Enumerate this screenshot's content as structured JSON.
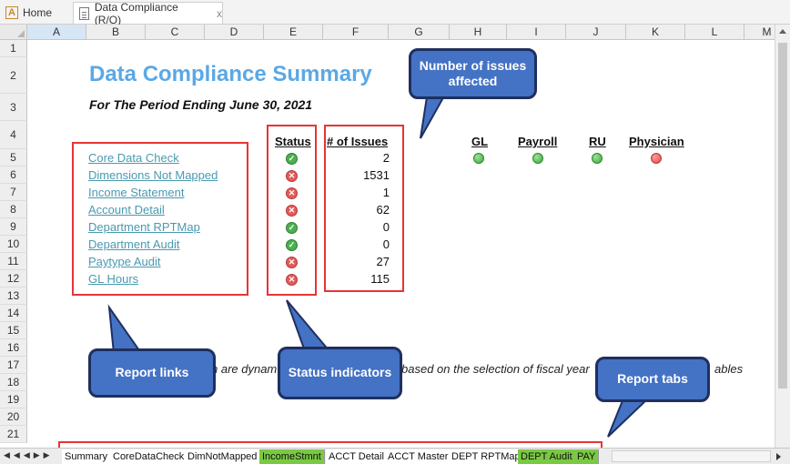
{
  "doc_tabs": {
    "home": "Home",
    "active": "Data Compliance (R/O)",
    "close": "x",
    "home_icon": "A"
  },
  "columns": [
    "A",
    "B",
    "C",
    "D",
    "E",
    "F",
    "G",
    "H",
    "I",
    "J",
    "K",
    "L",
    "M"
  ],
  "rows": [
    "1",
    "2",
    "3",
    "4",
    "5",
    "6",
    "7",
    "8",
    "9",
    "10",
    "11",
    "12",
    "13",
    "14",
    "15",
    "16",
    "17",
    "18",
    "19",
    "20",
    "21"
  ],
  "sheet": {
    "title": "Data Compliance Summary",
    "subtitle": "For The Period Ending June 30, 2021",
    "status_header": "Status",
    "issues_header": "# of Issues",
    "reports": [
      {
        "name": "Core Data Check",
        "status": "ok",
        "issues": "2"
      },
      {
        "name": "Dimensions Not Mapped",
        "status": "fail",
        "issues": "1531"
      },
      {
        "name": "Income Statement",
        "status": "fail",
        "issues": "1"
      },
      {
        "name": "Account Detail",
        "status": "fail",
        "issues": "62"
      },
      {
        "name": "Department RPTMap",
        "status": "ok",
        "issues": "0"
      },
      {
        "name": "Department Audit",
        "status": "ok",
        "issues": "0"
      },
      {
        "name": "Paytype Audit",
        "status": "fail",
        "issues": "27"
      },
      {
        "name": "GL Hours",
        "status": "fail",
        "issues": "115"
      }
    ],
    "indicators": [
      {
        "label": "GL",
        "status": "green"
      },
      {
        "label": "Payroll",
        "status": "green"
      },
      {
        "label": "RU",
        "status": "green"
      },
      {
        "label": "Physician",
        "status": "red"
      }
    ],
    "note_left": "n are dynam",
    "note_mid": "based on the selection of fiscal year",
    "note_right": "ables"
  },
  "callouts": {
    "issues": "Number of issues affected",
    "links": "Report links",
    "status": "Status indicators",
    "tabs": "Report tabs"
  },
  "sheet_tabs": [
    {
      "label": "Summary",
      "color": "#ffffff"
    },
    {
      "label": "CoreDataCheck",
      "color": "#ffffff"
    },
    {
      "label": "DimNotMapped",
      "color": "#ffffff"
    },
    {
      "label": "IncomeStmnt",
      "color": "#7ac943"
    },
    {
      "label": "ACCT Detail",
      "color": "#ffffff"
    },
    {
      "label": "ACCT Master",
      "color": "#ffffff"
    },
    {
      "label": "DEPT RPTMap",
      "color": "#ffffff"
    },
    {
      "label": "DEPT Audit",
      "color": "#7ac943"
    },
    {
      "label": "PAY",
      "color": "#7ac943"
    }
  ],
  "colors": {
    "title": "#5ba8e5",
    "link": "#4a9ab0",
    "highlight": "#e53535",
    "callout": "#4472c4"
  }
}
